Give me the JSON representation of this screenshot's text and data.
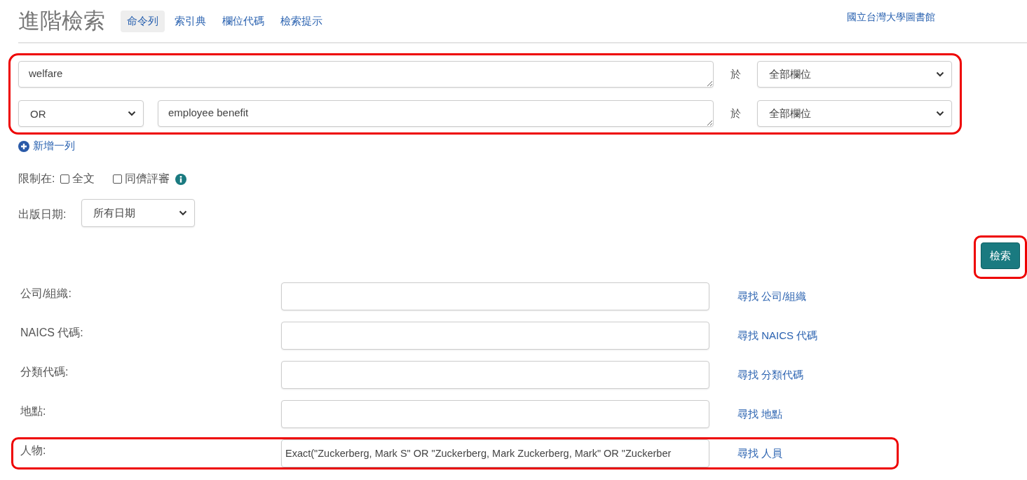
{
  "header": {
    "title": "進階檢索",
    "tabs": [
      {
        "label": "命令列",
        "selected": true
      },
      {
        "label": "索引典",
        "selected": false
      },
      {
        "label": "欄位代碼",
        "selected": false
      },
      {
        "label": "檢索提示",
        "selected": false
      }
    ],
    "library_link": "國立台灣大學圖書館"
  },
  "query": {
    "highlighted": true,
    "rows": [
      {
        "operator": null,
        "term": "welfare",
        "in_label": "於",
        "field": "全部欄位"
      },
      {
        "operator": "OR",
        "term": "employee benefit",
        "in_label": "於",
        "field": "全部欄位"
      }
    ]
  },
  "add_row": "新增一列",
  "limits": {
    "label": "限制在:",
    "options": [
      {
        "label": "全文",
        "checked": false,
        "info": false
      },
      {
        "label": "同儕評審",
        "checked": false,
        "info": true
      }
    ]
  },
  "date": {
    "label": "出版日期:",
    "value": "所有日期"
  },
  "search_button": {
    "label": "檢索",
    "highlighted": true
  },
  "fields": [
    {
      "label": "公司/組織:",
      "link": "尋找 公司/組織",
      "highlighted": false
    },
    {
      "label": "NAICS 代碼:",
      "link": "尋找 NAICS 代碼",
      "highlighted": false
    },
    {
      "label": "分類代碼:",
      "link": "尋找 分類代碼",
      "highlighted": false
    },
    {
      "label": "地點:",
      "link": "尋找 地點",
      "highlighted": false
    },
    {
      "label": "人物:",
      "value": "Exact(\"Zuckerberg, Mark S\" OR \"Zuckerberg, Mark Zuckerberg, Mark\" OR \"Zuckerber",
      "link": "尋找 人員",
      "highlighted": true
    }
  ]
}
